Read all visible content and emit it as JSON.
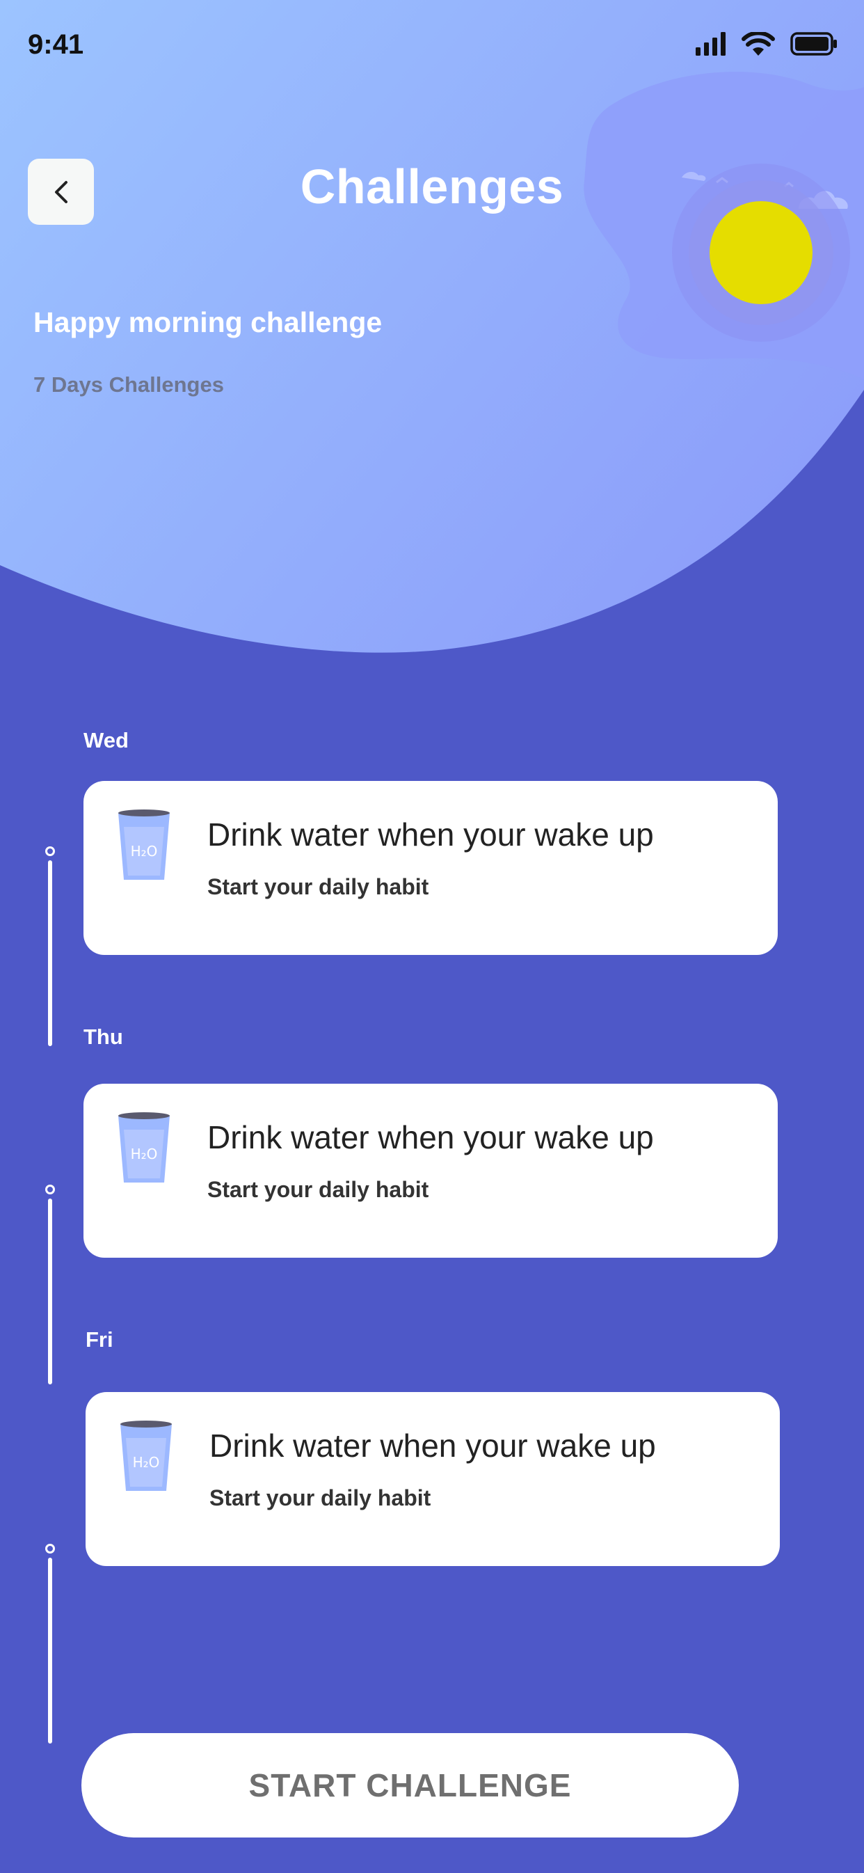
{
  "status_bar": {
    "time": "9:41",
    "icons": [
      "signal-icon",
      "wifi-icon",
      "battery-icon"
    ]
  },
  "header": {
    "back_icon": "chevron-left-icon",
    "title": "Challenges",
    "illustration": "sun-illustration"
  },
  "challenge": {
    "name": "Happy morning challenge",
    "subtitle": "7 Days Challenges"
  },
  "days": [
    {
      "day": "Wed",
      "title": "Drink water when your wake up",
      "subtitle": "Start your daily habit",
      "icon": "water-glass-icon"
    },
    {
      "day": "Thu",
      "title": "Drink water when your wake up",
      "subtitle": "Start your daily habit",
      "icon": "water-glass-icon"
    },
    {
      "day": "Fri",
      "title": "Drink water when your wake up",
      "subtitle": "Start your daily habit",
      "icon": "water-glass-icon"
    }
  ],
  "cta": {
    "label": "START CHALLENGE"
  },
  "colors": {
    "background": "#4e58c8",
    "header_light": "#9cc3ff",
    "header_mid": "#8fa6fb",
    "sun": "#e5dd00",
    "card": "#ffffff"
  }
}
